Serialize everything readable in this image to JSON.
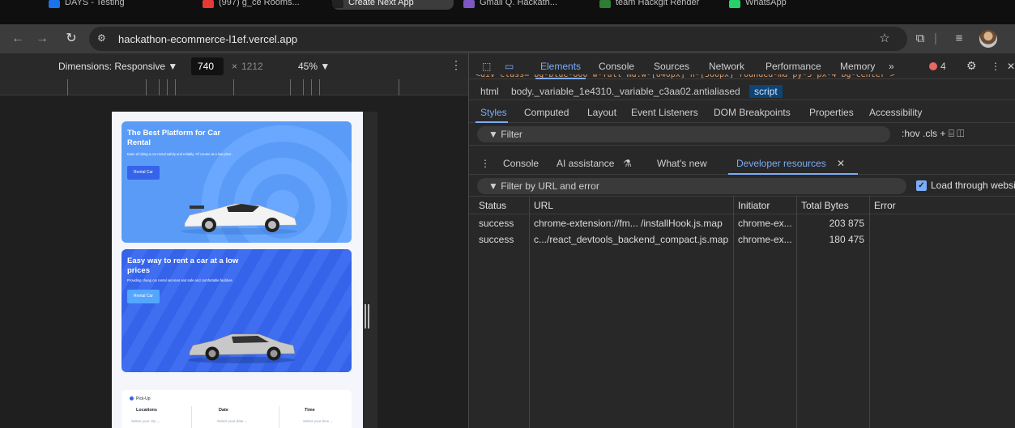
{
  "browser": {
    "tabs": [
      {
        "title": "DAYS - Testing",
        "color": "#1a73e8"
      },
      {
        "title": "(997) g_ce Rooms...",
        "color": "#e53935"
      },
      {
        "title": "Create Next App",
        "color": "#222222",
        "active": true
      },
      {
        "title": "Gmail Q. Hackath...",
        "color": "#7e57c2"
      },
      {
        "title": "team Hackgit Render",
        "color": "#2e7d32"
      },
      {
        "title": "WhatsApp",
        "color": "#25d366"
      }
    ],
    "url": "hackathon-ecommerce-l1ef.vercel.app"
  },
  "device_toolbar": {
    "dimensions_label": "Dimensions: Responsive ▼",
    "width": "740",
    "x": "×",
    "height": "1212",
    "zoom": "45% ▼"
  },
  "site": {
    "hero1": {
      "title": "The Best Platform for Car Rental",
      "subtitle": "Ease of doing a car rental safely and reliably. Of course at a low price.",
      "button": "Rental Car"
    },
    "hero2": {
      "title": "Easy way to rent a car at a low prices",
      "subtitle": "Providing cheap car rental services and safe and comfortable facilities.",
      "button": "Rental Car"
    },
    "pickup": {
      "label": "Pick-Up",
      "columns": [
        {
          "title": "Locations",
          "value": "Select your city"
        },
        {
          "title": "Date",
          "value": "Select your date"
        },
        {
          "title": "Time",
          "value": "Select your time"
        }
      ]
    },
    "colors": {
      "primary": "#3563e9",
      "hero1": "#54a6ff"
    }
  },
  "devtools": {
    "main_tabs": [
      "Elements",
      "Console",
      "Sources",
      "Network",
      "Performance",
      "Memory",
      "»"
    ],
    "error_count": "4",
    "breadcrumbs": [
      "html",
      "body._variable_1e4310._variable_c3aa02.antialiased",
      "script"
    ],
    "style_tabs": [
      "Styles",
      "Computed",
      "Layout",
      "Event Listeners",
      "DOM Breakpoints",
      "Properties",
      "Accessibility"
    ],
    "filter_placeholder": "Filter",
    "filter_tools": ":hov  .cls",
    "drawer_tabs": [
      "Console",
      "AI assistance",
      "What's new",
      "Developer resources"
    ],
    "resource_filter_placeholder": "Filter by URL and error",
    "load_through": "Load through website",
    "table": {
      "headers": [
        "Status",
        "URL",
        "Initiator",
        "Total Bytes",
        "Error"
      ],
      "rows": [
        {
          "status": "success",
          "url": "chrome-extension://fm... /installHook.js.map",
          "initiator": "chrome-ex...",
          "bytes": "203 875",
          "error": ""
        },
        {
          "status": "success",
          "url": "c.../react_devtools_backend_compact.js.map",
          "initiator": "chrome-ex...",
          "bytes": "180 475",
          "error": ""
        }
      ]
    }
  }
}
